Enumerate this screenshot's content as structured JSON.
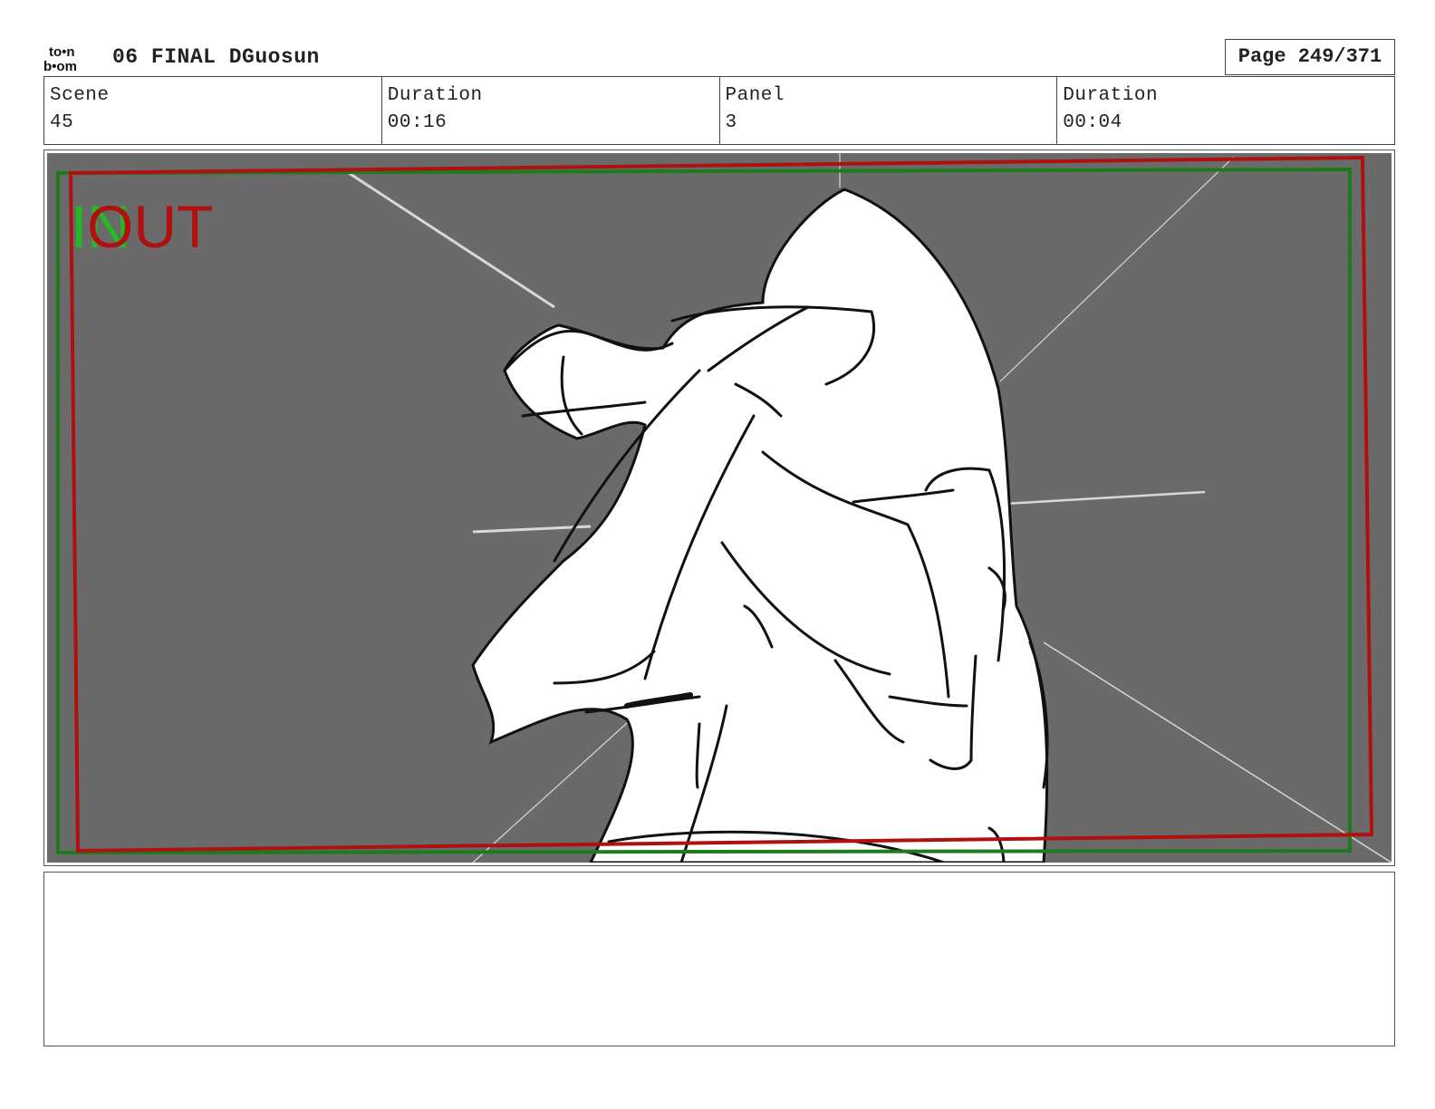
{
  "header": {
    "logo_top": "to•n",
    "logo_bottom": "b•om",
    "title": "06 FINAL DGuosun",
    "page": "Page 249/371"
  },
  "info": {
    "scene_label": "Scene",
    "scene_value": "45",
    "scene_duration_label": "Duration",
    "scene_duration_value": "00:16",
    "panel_label": "Panel",
    "panel_value": "3",
    "panel_duration_label": "Duration",
    "panel_duration_value": "00:04"
  },
  "panel": {
    "in_label": "IN",
    "out_label": "OUT",
    "colors": {
      "background": "#6a6a6a",
      "figure": "#ffffff",
      "ink": "#111111",
      "in_frame": "#1d7a1d",
      "out_frame": "#b01010",
      "in_text": "#22bb22"
    }
  },
  "notes": {
    "text": ""
  }
}
